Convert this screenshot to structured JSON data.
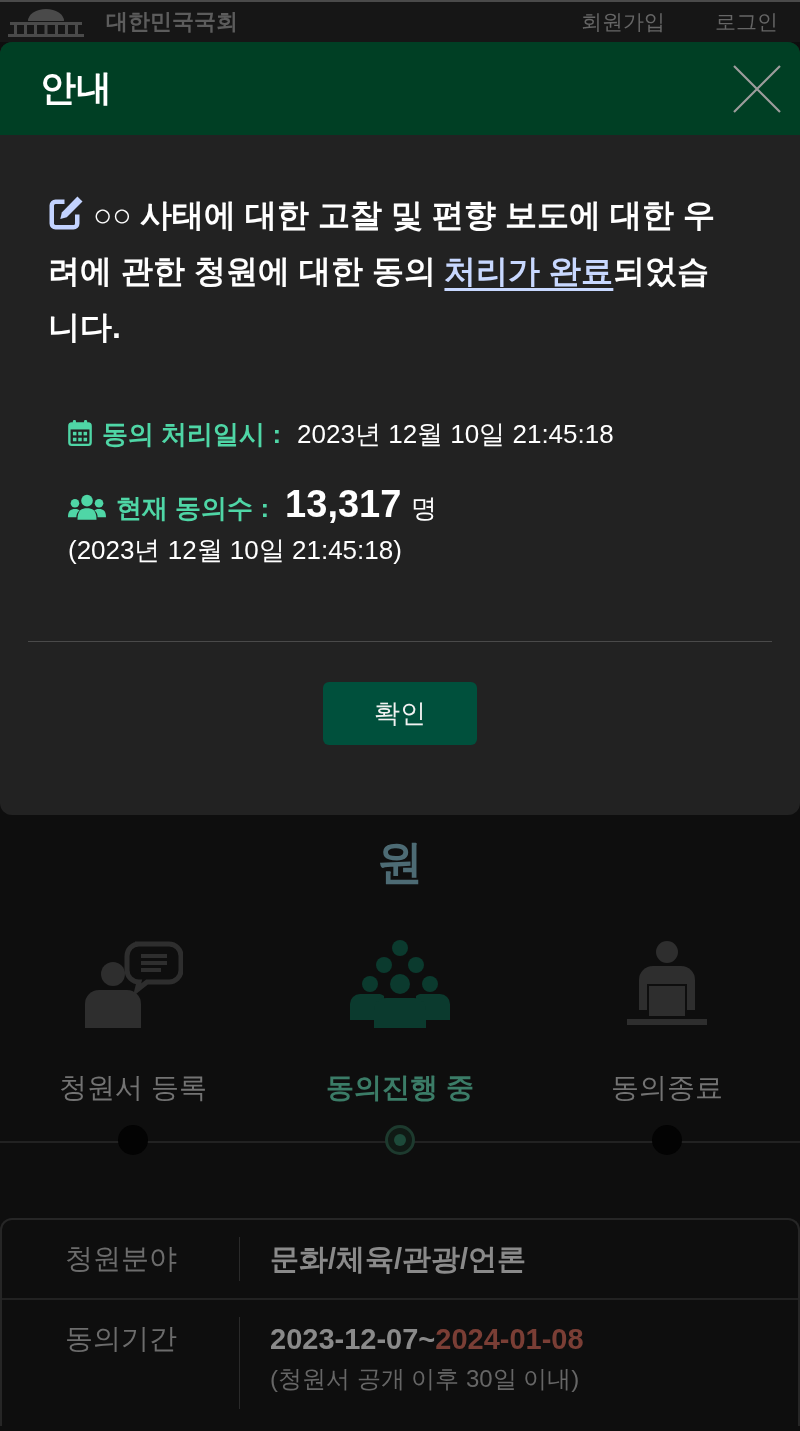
{
  "page_header": {
    "site_name": "대한민국국회",
    "links": [
      "회원가입",
      "로그인"
    ]
  },
  "dialog": {
    "title": "안내",
    "message": {
      "text_before": "○○ 사태에 대한 고찰 및 편향 보도에 대한 우려에 관한 청원에 대한 동의 ",
      "link": "처리가 완료",
      "text_after": "되었습니다."
    },
    "info": [
      {
        "kind": "time",
        "label": "동의 처리일시 :",
        "value": "2023년 12월 10일 21:45:18"
      },
      {
        "kind": "count",
        "label": "현재 동의수 :",
        "count": "13,317",
        "unit": "명",
        "timestamp": "(2023년 12월 10일 21:45:18)"
      }
    ],
    "confirm_button": "확인"
  },
  "petition_title_visible": "원",
  "steps": [
    {
      "label": "청원서 등록",
      "selected": false
    },
    {
      "label": "동의진행 중",
      "selected": true
    },
    {
      "label": "동의종료",
      "selected": false
    }
  ],
  "details": [
    {
      "kind": "text",
      "label": "청원분야",
      "value": "문화/체육/관광/언론"
    },
    {
      "kind": "period",
      "label": "동의기간",
      "start": "2023-12-07~",
      "end": "2024-01-08",
      "note": "(청원서 공개 이후 30일 이내)"
    }
  ]
}
